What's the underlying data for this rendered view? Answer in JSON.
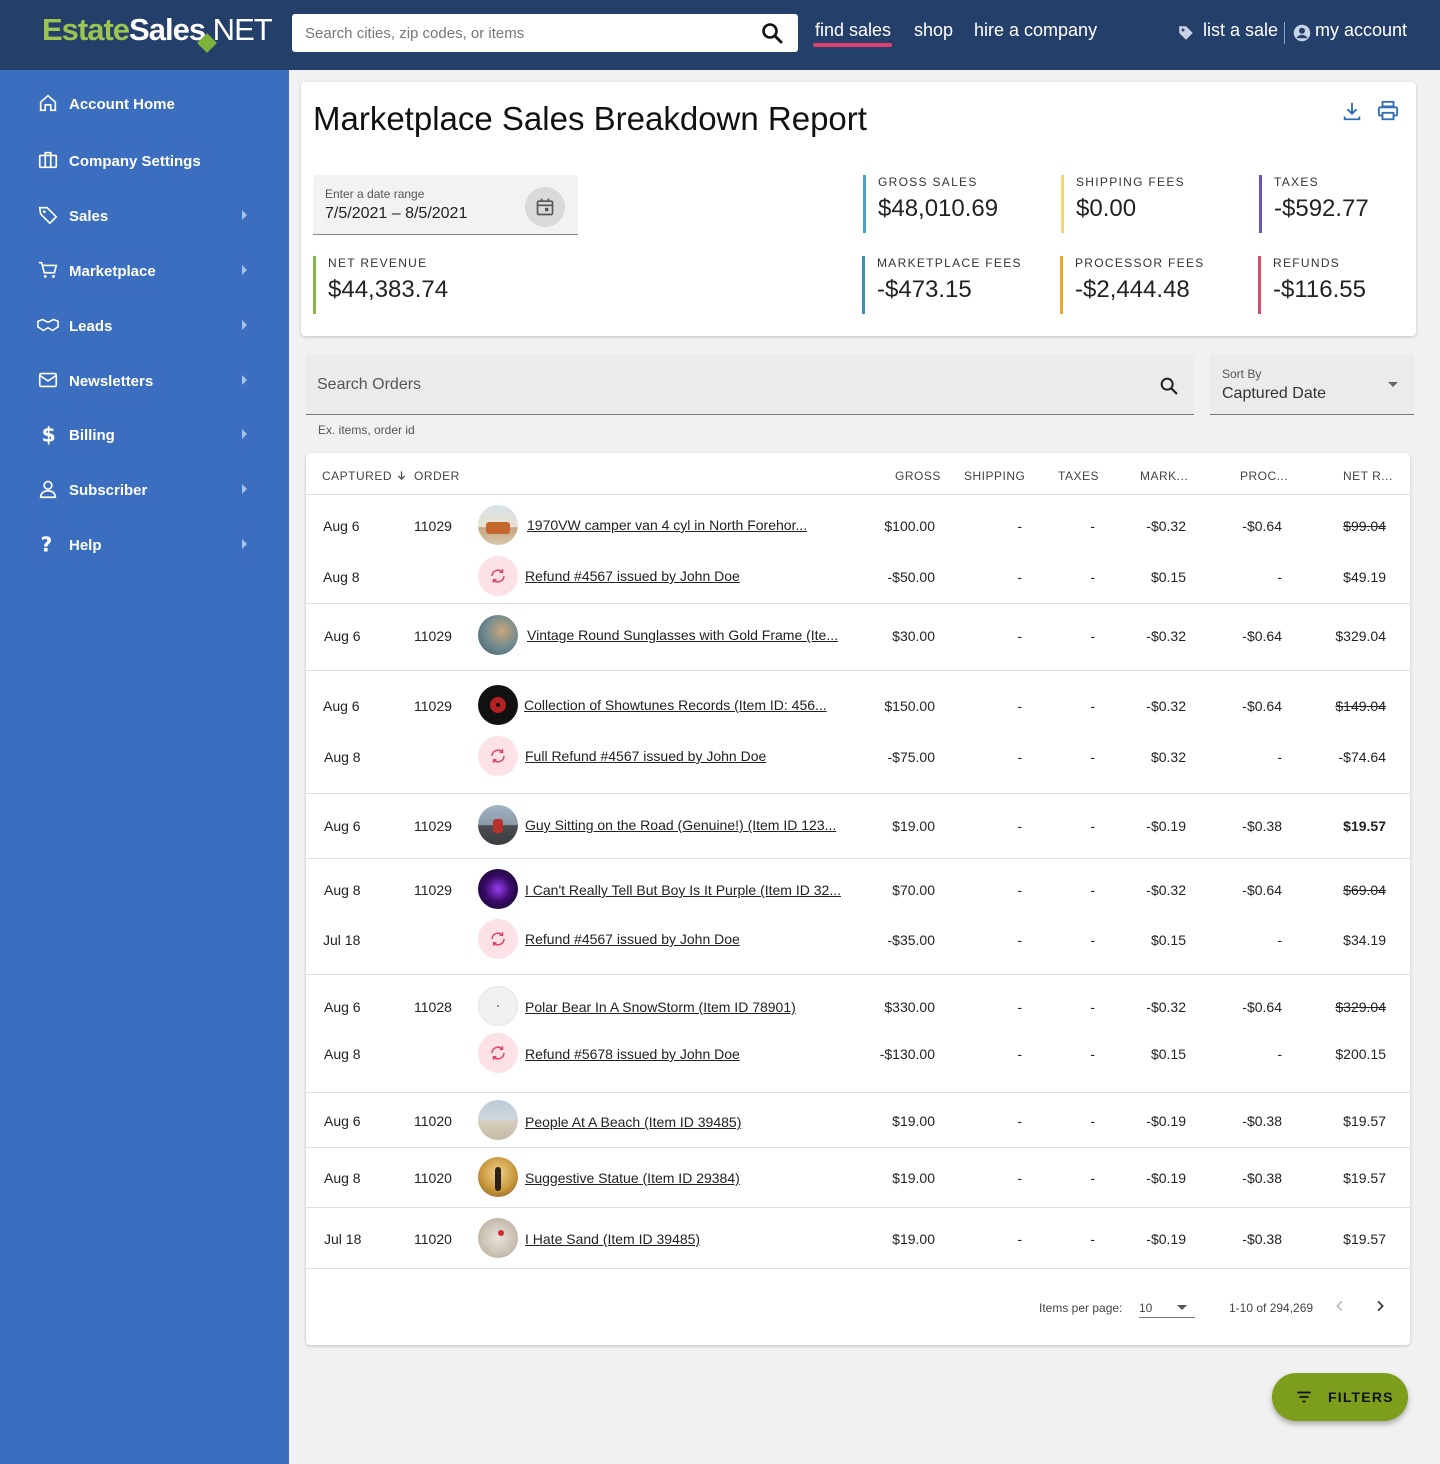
{
  "header": {
    "logo": {
      "part1": "Estate",
      "part2": "Sales",
      "part3": ".NET"
    },
    "search_placeholder": "Search cities, zip codes, or items",
    "nav": [
      "find sales",
      "shop",
      "hire a company"
    ],
    "list_sale": "list a sale",
    "my_account": "my account"
  },
  "sidebar": {
    "items": [
      {
        "label": "Account Home",
        "icon": "home-icon"
      },
      {
        "label": "Company Settings",
        "icon": "briefcase-icon"
      },
      {
        "label": "Sales",
        "icon": "tag-icon"
      },
      {
        "label": "Marketplace",
        "icon": "cart-icon"
      },
      {
        "label": "Leads",
        "icon": "handshake-icon"
      },
      {
        "label": "Newsletters",
        "icon": "mail-icon"
      },
      {
        "label": "Billing",
        "icon": "dollar-icon"
      },
      {
        "label": "Subscriber",
        "icon": "person-icon"
      },
      {
        "label": "Help",
        "icon": "question-icon"
      }
    ]
  },
  "report": {
    "title": "Marketplace Sales Breakdown Report",
    "date_label": "Enter a date range",
    "date_value": "7/5/2021 – 8/5/2021",
    "stats": {
      "gross": {
        "label": "GROSS SALES",
        "value": "$48,010.69",
        "color": "#4aa3c8"
      },
      "shipping": {
        "label": "SHIPPING FEES",
        "value": "$0.00",
        "color": "#f2d675"
      },
      "taxes": {
        "label": "TAXES",
        "value": "-$592.77",
        "color": "#6a55b5"
      },
      "net": {
        "label": "NET REVENUE",
        "value": "$44,383.74",
        "color": "#8ab34a"
      },
      "marketplace": {
        "label": "MARKETPLACE FEES",
        "value": "-$473.15",
        "color": "#3b8fc0"
      },
      "processor": {
        "label": "PROCESSOR FEES",
        "value": "-$2,444.48",
        "color": "#f0a72a"
      },
      "refunds": {
        "label": "REFUNDS",
        "value": "-$116.55",
        "color": "#d94a6d"
      }
    }
  },
  "orders": {
    "search_placeholder": "Search Orders",
    "hint": "Ex. items, order id",
    "sort_label": "Sort By",
    "sort_value": "Captured Date"
  },
  "table": {
    "headers": {
      "captured": "CAPTURED",
      "order": "ORDER",
      "gross": "GROSS",
      "shipping": "SHIPPING",
      "taxes": "TAXES",
      "mark": "MARK...",
      "proc": "PROC...",
      "net": "NET R..."
    },
    "rows": [
      {
        "date": "Aug 6",
        "order": "11029",
        "item": "1970VW camper van 4 cyl in North Forehor...",
        "gross": "$100.00",
        "shipping": "-",
        "taxes": "-",
        "mark": "-$0.32",
        "proc": "-$0.64",
        "net": "$99.04"
      },
      {
        "date": "Aug 8",
        "order": "",
        "item": "Refund #4567 issued by John Doe",
        "gross": "-$50.00",
        "shipping": "-",
        "taxes": "-",
        "mark": "$0.15",
        "proc": "-",
        "net": "$49.19"
      },
      {
        "date": "Aug 6",
        "order": "11029",
        "item": "Vintage Round Sunglasses with Gold Frame (Ite...",
        "gross": "$30.00",
        "shipping": "-",
        "taxes": "-",
        "mark": "-$0.32",
        "proc": "-$0.64",
        "net": "$329.04"
      },
      {
        "date": "Aug 6",
        "order": "11029",
        "item": "Collection of Showtunes Records (Item ID: 456...",
        "gross": "$150.00",
        "shipping": "-",
        "taxes": "-",
        "mark": "-$0.32",
        "proc": "-$0.64",
        "net": "$149.04"
      },
      {
        "date": "Aug 8",
        "order": "",
        "item": "Full Refund #4567 issued by John Doe",
        "gross": "-$75.00",
        "shipping": "-",
        "taxes": "-",
        "mark": "$0.32",
        "proc": "-",
        "net": "-$74.64"
      },
      {
        "date": "Aug 6",
        "order": "11029",
        "item": "Guy Sitting on the Road (Genuine!) (Item ID 123...",
        "gross": "$19.00",
        "shipping": "-",
        "taxes": "-",
        "mark": "-$0.19",
        "proc": "-$0.38",
        "net": "$19.57"
      },
      {
        "date": "Aug 8",
        "order": "11029",
        "item": "I Can't Really Tell But Boy Is It Purple (Item ID 32...",
        "gross": "$70.00",
        "shipping": "-",
        "taxes": "-",
        "mark": "-$0.32",
        "proc": "-$0.64",
        "net": "$69.04"
      },
      {
        "date": "Jul 18",
        "order": "",
        "item": "Refund #4567 issued by John Doe",
        "gross": "-$35.00",
        "shipping": "-",
        "taxes": "-",
        "mark": "$0.15",
        "proc": "-",
        "net": "$34.19"
      },
      {
        "date": "Aug 6",
        "order": "11028",
        "item": "Polar Bear In A SnowStorm (Item ID 78901)",
        "gross": "$330.00",
        "shipping": "-",
        "taxes": "-",
        "mark": "-$0.32",
        "proc": "-$0.64",
        "net": "$329.04"
      },
      {
        "date": "Aug 8",
        "order": "",
        "item": "Refund #5678 issued by John Doe",
        "gross": "-$130.00",
        "shipping": "-",
        "taxes": "-",
        "mark": "$0.15",
        "proc": "-",
        "net": "$200.15"
      },
      {
        "date": "Aug 6",
        "order": "11020",
        "item": "People At A Beach (Item ID 39485)",
        "gross": "$19.00",
        "shipping": "-",
        "taxes": "-",
        "mark": "-$0.19",
        "proc": "-$0.38",
        "net": "$19.57"
      },
      {
        "date": "Aug 8",
        "order": "11020",
        "item": "Suggestive Statue (Item ID 29384)",
        "gross": "$19.00",
        "shipping": "-",
        "taxes": "-",
        "mark": "-$0.19",
        "proc": "-$0.38",
        "net": "$19.57"
      },
      {
        "date": "Jul 18",
        "order": "11020",
        "item": "I Hate Sand (Item ID 39485)",
        "gross": "$19.00",
        "shipping": "-",
        "taxes": "-",
        "mark": "-$0.19",
        "proc": "-$0.38",
        "net": "$19.57"
      }
    ]
  },
  "pagination": {
    "label": "Items per page:",
    "per_page": "10",
    "range": "1-10 of 294,269"
  },
  "filters_label": "FILTERS"
}
